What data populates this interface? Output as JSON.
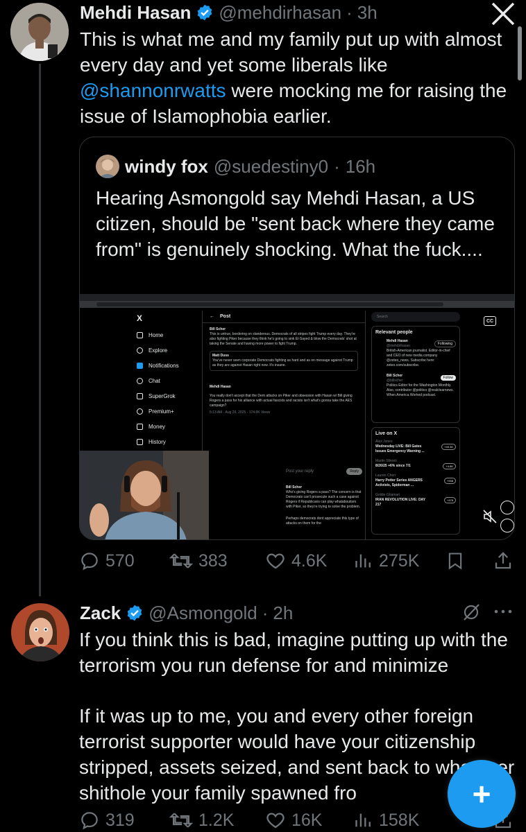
{
  "top_bar": {
    "close_label": "X"
  },
  "tweet1": {
    "author_name": "Mehdi Hasan",
    "handle": "@mehdirhasan",
    "time": "3h",
    "text_before_mention": "This is what me and my family put up with almost every day and yet some liberals like ",
    "mention": "@shannonrwatts",
    "text_after_mention": " were mocking me for raising the issue of Islamophobia earlier.",
    "quote": {
      "author_name": "windy fox",
      "handle": "@suedestiny0",
      "time": "16h",
      "text": "Hearing Asmongold say Mehdi Hasan, a US citizen, should be \"sent back where they came from\" is genuinely shocking. What the fuck....",
      "embedded": {
        "nav": [
          "Home",
          "Explore",
          "Notifications",
          "Chat",
          "SuperGrok",
          "Premium+",
          "Money",
          "History"
        ],
        "post_header": "Post",
        "search_placeholder": "Search",
        "relevant_people_title": "Relevant people",
        "reply_placeholder": "Post your reply",
        "reply_button": "Reply",
        "live_title": "Live on X",
        "cc_label": "CC",
        "scher_name": "Bill Scher",
        "scher_text": "This is untrue, bordering on slanderous. Democrats of all stripes fight Trump every day. They're also fighting Piker because they think he's going to sink El-Sayed & blow the Democrats' shot at taking the Senate and having more power to fight Trump.",
        "duss_name": "Matt Duss",
        "duss_text": "You've never seen corporate Democrats fighting as hard and as on message against Trump as they are against Hasan right now. It's insane.",
        "hasan_name": "Mehdi Hasan",
        "hasan_text": "You really don't accept that the Dem attacks on Piker and obsession with Hasan w/ Bill giving Rogers a pass for his alliance with actual fascists and racists isn't what's gonna take the AES campaign?",
        "hasan_meta": "5:13 AM · Aug 26, 2025 · 174.8K Views",
        "scher2_text": "Who's giving Rogers a pass? The concern is that Democrats can't prosecute such a case against Rogers if Republicans can play whataboutism with Piker, so they're trying to solve the problem.",
        "last_text": "Perhaps democrats dont appreciate this type of attacks on them for the",
        "people": [
          {
            "name": "Mehdi Hasan",
            "handle": "@mehdirhasan",
            "bio": "British-American journalist. Editor-in-chief and CEO of new media company @zeteo_news. Subscribe here: zeteo.com/subscribe.",
            "button": "Following"
          },
          {
            "name": "Bill Scher",
            "handle": "@billscher",
            "bio": "Politics Editor for the Washington Monthly. Also, contributor @politico @realclearnews. When America Worked podcast.",
            "button": "Follow"
          }
        ],
        "live": [
          {
            "host": "Alex Jones",
            "title": "Wednesday LIVE: Bill Gates Issues Emergency Warning ...",
            "count": "+49.3K"
          },
          {
            "host": "Martin Shkreli",
            "title": "8/26/25 +6% since 7/1",
            "count": "+4.8K"
          },
          {
            "host": "Lauren Chen",
            "title": "Harry Potter Series ANGERS Activists, Spiderman ...",
            "count": "+938"
          },
          {
            "host": "Goldie Ghamari",
            "title": "IRAN REVOLUTION LIVE: DAY 217",
            "count": "+478"
          }
        ]
      }
    },
    "stats": {
      "replies": "570",
      "reposts": "383",
      "likes": "4.6K",
      "views": "275K"
    }
  },
  "tweet2": {
    "author_name": "Zack",
    "handle": "@Asmongold",
    "time": "2h",
    "paragraph1": "If you think this is bad, imagine putting up with the terrorism you run defense for and minimize",
    "paragraph2": "If it was up to me, you and every other foreign terrorist supporter would have your citizenship stripped, assets seized, and sent back to whatever shithole your family spawned fro",
    "stats": {
      "replies": "319",
      "reposts": "1.2K",
      "likes": "16K",
      "views": "158K"
    }
  },
  "fab": {
    "label": "+"
  },
  "colors": {
    "background": "#000000",
    "text": "#e7e9ea",
    "muted": "#71767b",
    "accent": "#1d9bf0",
    "border": "#2f3336"
  }
}
